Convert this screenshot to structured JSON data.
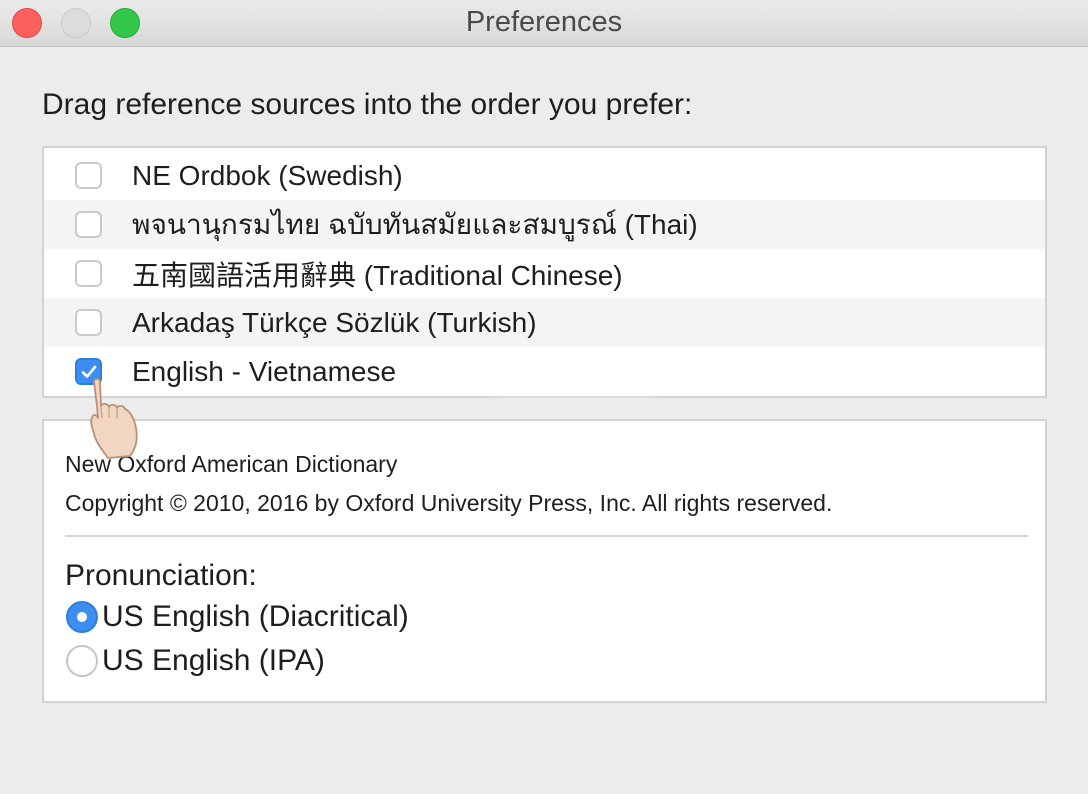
{
  "window": {
    "title": "Preferences"
  },
  "instructions": "Drag reference sources into the order you prefer:",
  "sources": [
    {
      "label": "NE Ordbok (Swedish)",
      "checked": false
    },
    {
      "label": "พจนานุกรมไทย ฉบับทันสมัยและสมบูรณ์ (Thai)",
      "checked": false
    },
    {
      "label": "五南國語活用辭典 (Traditional Chinese)",
      "checked": false
    },
    {
      "label": "Arkadaş Türkçe Sözlük (Turkish)",
      "checked": false
    },
    {
      "label": "English - Vietnamese",
      "checked": true
    }
  ],
  "info": {
    "dictionary_name": "New Oxford American Dictionary",
    "copyright": "Copyright © 2010, 2016 by Oxford University Press, Inc. All rights reserved.",
    "pronunciation_label": "Pronunciation:",
    "pronunciation_options": [
      {
        "label": "US English (Diacritical)",
        "selected": true
      },
      {
        "label": "US English (IPA)",
        "selected": false
      }
    ]
  },
  "icons": {
    "close": "close-traffic-light",
    "minimize": "minimize-traffic-light",
    "maximize": "zoom-traffic-light",
    "cursor": "pointing-hand-cursor",
    "checkmark": "checkmark-icon"
  },
  "colors": {
    "accent": "#3d8ef0",
    "close": "#fc605c",
    "zoom": "#34c84a",
    "background": "#ececec"
  }
}
